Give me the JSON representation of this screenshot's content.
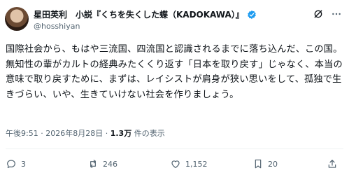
{
  "author": {
    "display_name": "星田英利　小説『くちを失くした蝶（KADOKAWA）』",
    "handle": "@hosshiyan"
  },
  "tweet": {
    "text": "国際社会から、もはや三流国、四流国と認識されるまでに落ち込んだ、この国。無知性の輩がカルトの経典みたくくり返す「日本を取り戻す」じゃなく、本当の意味で取り戻すために、まずは、レイシストが肩身が狭い思いをして、孤独で生きづらい、いや、生きていけない社会を作りましょう。"
  },
  "meta": {
    "time": "午後9:51",
    "separator": " · ",
    "date": "2026年8月28日",
    "views_count": "1.3万",
    "views_label": " 件の表示"
  },
  "actions": {
    "replies": "3",
    "reposts": "246",
    "likes": "1,152",
    "bookmarks": "20"
  },
  "colors": {
    "verified_blue": "#1d9bf0",
    "text_primary": "#0f1419",
    "text_secondary": "#536471"
  },
  "icons": {
    "verified": "verified-badge-icon",
    "grok": "grok-icon",
    "more": "more-icon",
    "reply": "reply-icon",
    "repost": "repost-icon",
    "like": "like-icon",
    "bookmark": "bookmark-icon",
    "share": "share-icon"
  }
}
